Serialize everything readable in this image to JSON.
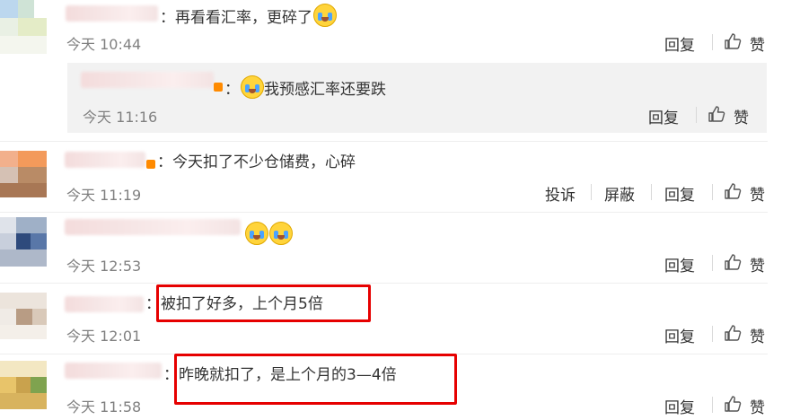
{
  "comments": [
    {
      "text": "再看看汇率，更碎了",
      "time": "今天 10:44"
    },
    {
      "text": "今天扣了不少仓储费，心碎",
      "time": "今天 11:19"
    },
    {
      "text": "",
      "time": "今天 12:53"
    },
    {
      "text": "被扣了好多，上个月5倍",
      "time": "今天 12:01"
    },
    {
      "text": "昨晚就扣了，是上个月的3—4倍",
      "time": "今天 11:58"
    }
  ],
  "reply": {
    "text": "我预感汇率还要跌",
    "time": "今天 11:16"
  },
  "actions": {
    "reply": "回复",
    "like": "赞",
    "report": "投诉",
    "block": "屏蔽"
  },
  "colors": {
    "highlight": "#e60000",
    "reply_bg": "#f2f2f2",
    "time": "#808080"
  },
  "icons": {
    "like": "thumbs-up-icon",
    "emoji": "crying-face-emoji"
  }
}
